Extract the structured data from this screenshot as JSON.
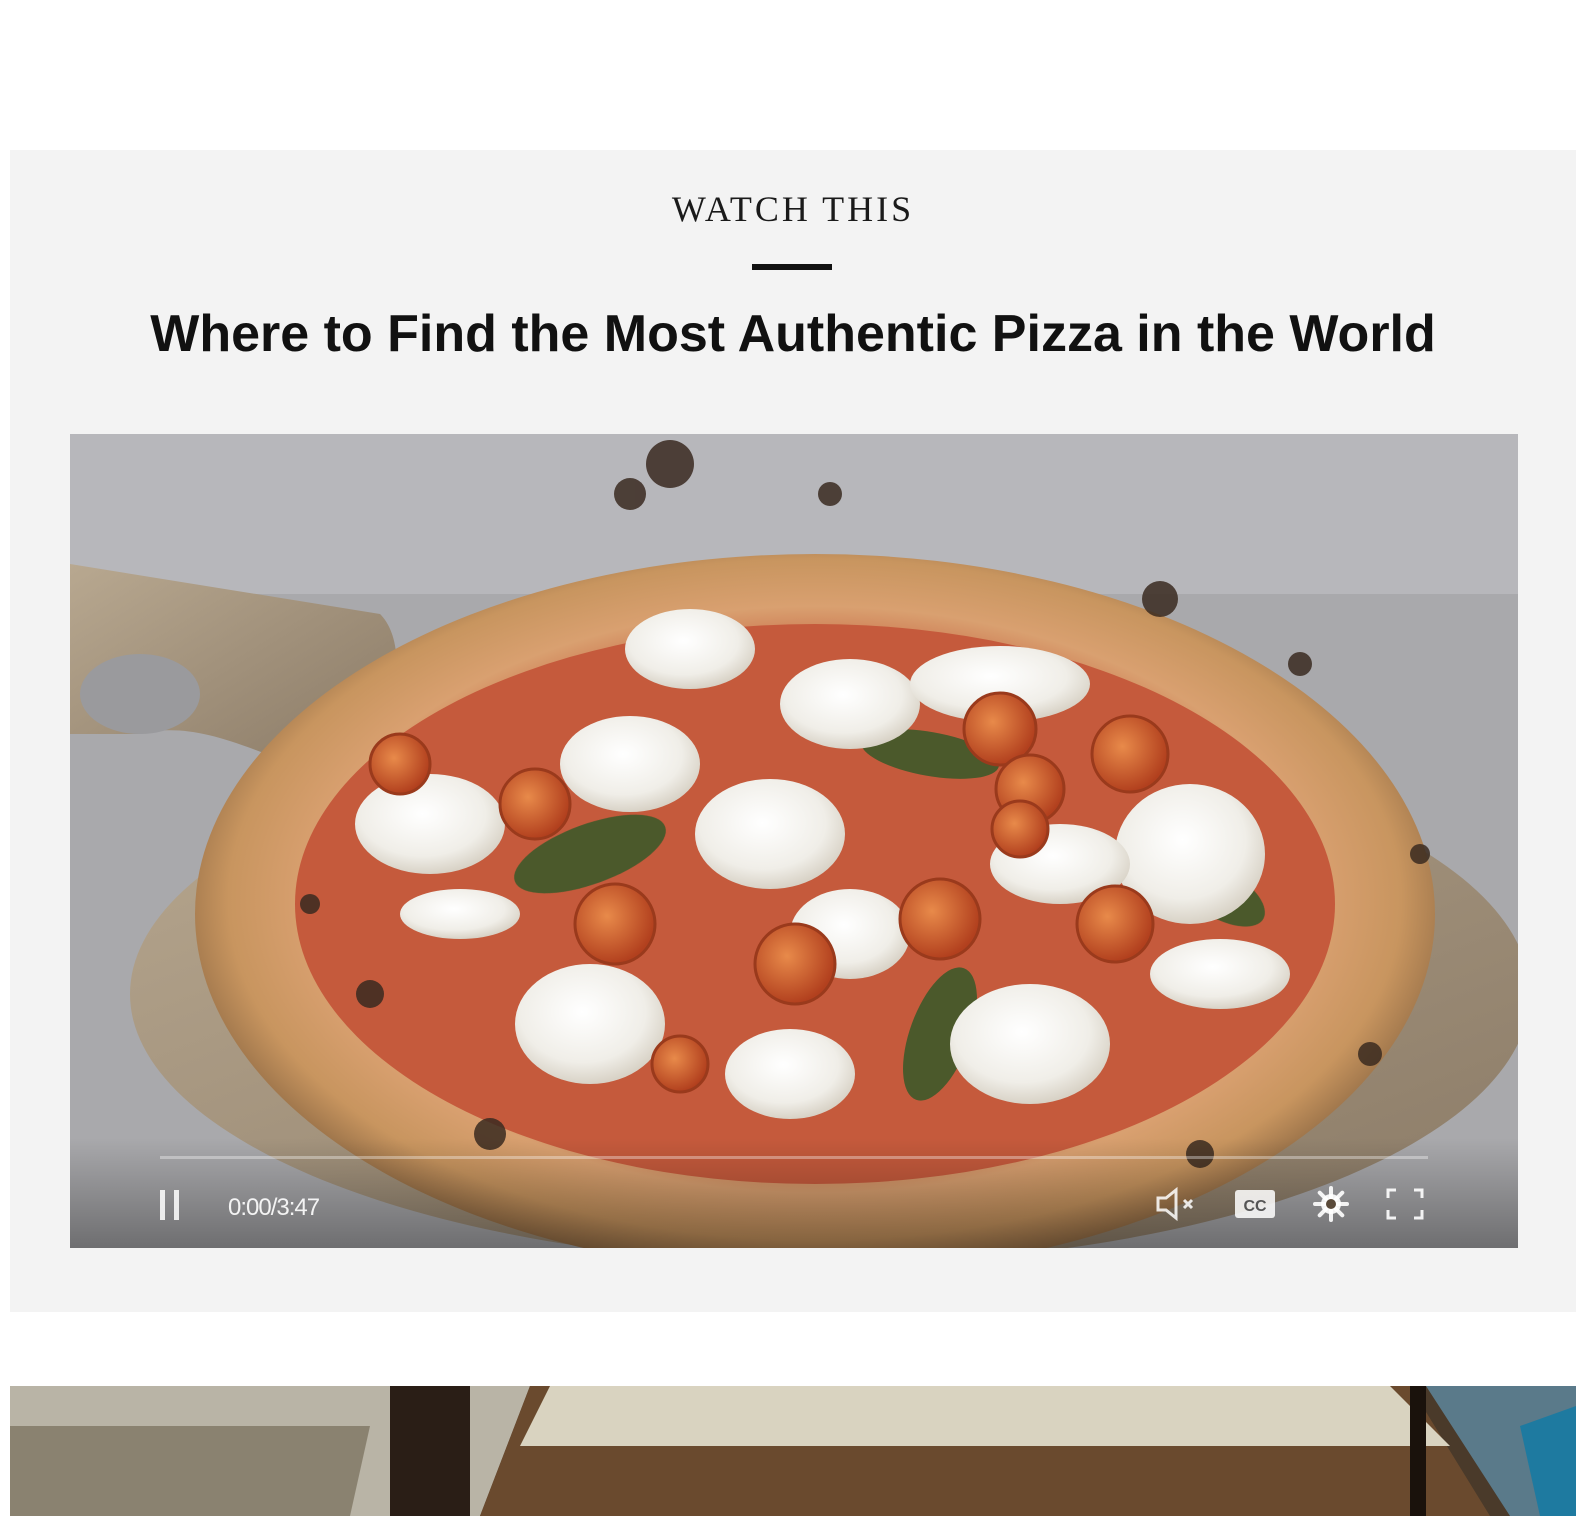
{
  "top_fragment": "",
  "section": {
    "eyebrow": "WATCH THIS",
    "headline": "Where to Find the Most Authentic Pizza in the World"
  },
  "video": {
    "current_time": "0:00",
    "duration": "3:47",
    "time_display": "0:00/3:47",
    "progress_percent": 0,
    "muted": true,
    "controls": {
      "play_state": "playing",
      "mute_icon": "volume-muted-icon",
      "cc_label": "CC",
      "settings_icon": "gear-icon",
      "fullscreen_icon": "fullscreen-icon"
    }
  },
  "colors": {
    "section_background": "#f3f3f3",
    "text": "#111111",
    "controls_foreground": "#ffffff"
  }
}
